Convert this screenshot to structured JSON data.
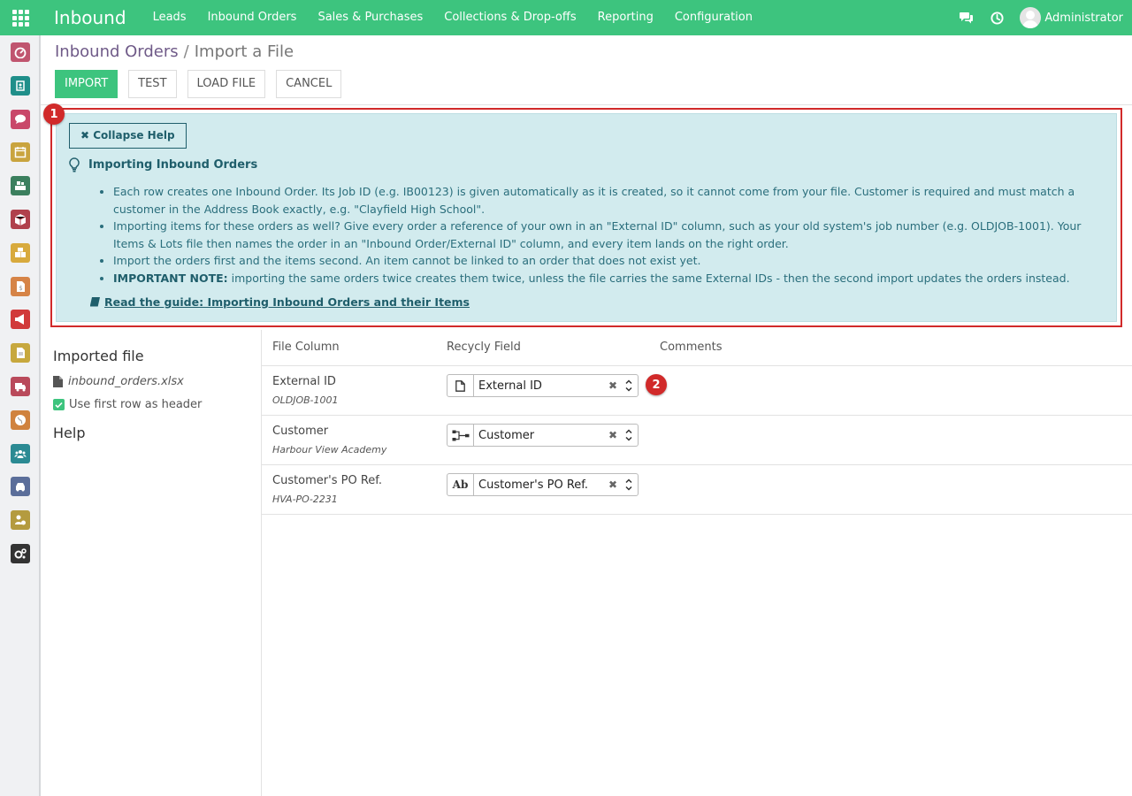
{
  "topbar": {
    "brand": "Inbound",
    "menu": [
      "Leads",
      "Inbound Orders",
      "Sales & Purchases",
      "Collections & Drop-offs",
      "Reporting",
      "Configuration"
    ],
    "user": "Administrator"
  },
  "sidebar": {
    "icons": [
      {
        "name": "dashboard-icon",
        "color": "#c0556f"
      },
      {
        "name": "contacts-icon",
        "color": "#1f8f8a"
      },
      {
        "name": "discuss-icon",
        "color": "#c9486a"
      },
      {
        "name": "calendar-icon",
        "color": "#c9a43f"
      },
      {
        "name": "inventory-icon",
        "color": "#3b7f5e"
      },
      {
        "name": "boxes-icon",
        "color": "#b0414c"
      },
      {
        "name": "packages-icon",
        "color": "#d8aa3d"
      },
      {
        "name": "invoicing-icon",
        "color": "#d68447"
      },
      {
        "name": "marketing-icon",
        "color": "#d13a3a"
      },
      {
        "name": "documents-icon",
        "color": "#c7a83e"
      },
      {
        "name": "fleet-truck-icon",
        "color": "#b94a5b"
      },
      {
        "name": "website-globe-icon",
        "color": "#d0823e"
      },
      {
        "name": "employees-icon",
        "color": "#2b8a93"
      },
      {
        "name": "vehicles-icon",
        "color": "#5b6e9a"
      },
      {
        "name": "user-settings-icon",
        "color": "#b49b3f"
      },
      {
        "name": "settings-icon",
        "color": "#333333"
      }
    ]
  },
  "breadcrumb": {
    "parent": "Inbound Orders",
    "separator": "/",
    "current": "Import a File"
  },
  "buttons": {
    "import": "IMPORT",
    "test": "TEST",
    "load_file": "LOAD FILE",
    "cancel": "CANCEL"
  },
  "help": {
    "badge": "1",
    "collapse_label": "Collapse Help",
    "title": "Importing Inbound Orders",
    "bullets": [
      {
        "strong": "",
        "text": "Each row creates one Inbound Order. Its Job ID (e.g. IB00123) is given automatically as it is created, so it cannot come from your file. Customer is required and must match a customer in the Address Book exactly, e.g. \"Clayfield High School\"."
      },
      {
        "strong": "",
        "text": "Importing items for these orders as well? Give every order a reference of your own in an \"External ID\" column, such as your old system's job number (e.g. OLDJOB-1001). Your Items & Lots file then names the order in an \"Inbound Order/External ID\" column, and every item lands on the right order."
      },
      {
        "strong": "",
        "text": "Import the orders first and the items second. An item cannot be linked to an order that does not exist yet."
      },
      {
        "strong": "IMPORTANT NOTE:",
        "text": " importing the same orders twice creates them twice, unless the file carries the same External IDs - then the second import updates the orders instead."
      }
    ],
    "guide_link": "Read the guide: Importing Inbound Orders and their Items"
  },
  "left": {
    "imported_file_title": "Imported file",
    "file_name": "inbound_orders.xlsx",
    "header_checkbox": "Use first row as header",
    "help_title": "Help"
  },
  "mapping": {
    "headers": {
      "file_column": "File Column",
      "field": "Recycly Field",
      "comments": "Comments"
    },
    "badge": "2",
    "rows": [
      {
        "column": "External ID",
        "sample": "OLDJOB-1001",
        "field": "External ID",
        "field_icon": "file-icon"
      },
      {
        "column": "Customer",
        "sample": "Harbour View Academy",
        "field": "Customer",
        "field_icon": "relation-icon"
      },
      {
        "column": "Customer's PO Ref.",
        "sample": "HVA-PO-2231",
        "field": "Customer's PO Ref.",
        "field_icon": "text-field-icon",
        "icon_text": "Ab"
      }
    ]
  }
}
